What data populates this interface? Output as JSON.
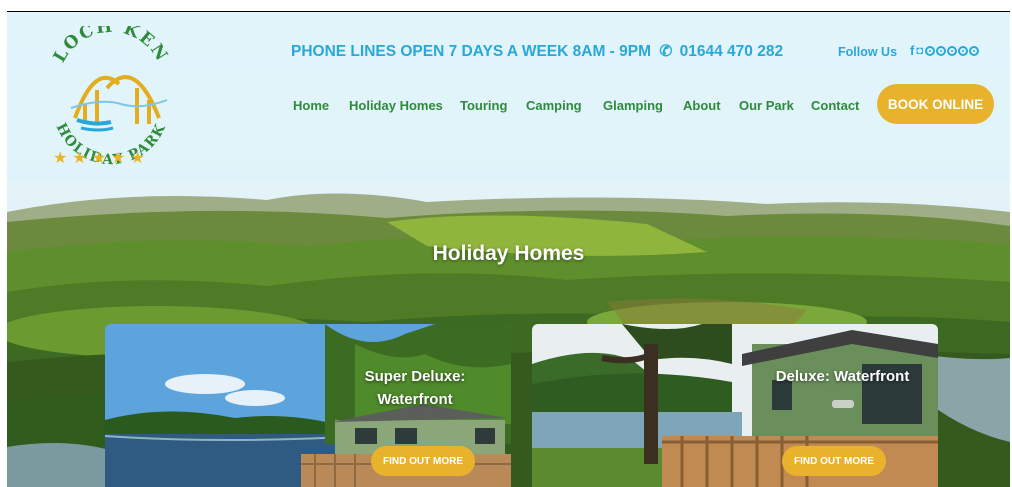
{
  "header": {
    "logo": {
      "line1": "LOCH KEN",
      "line2": "HOLIDAY PARK",
      "stars": "★★★★★"
    },
    "phone_text": "PHONE LINES OPEN 7 DAYS A WEEK 8AM - 9PM",
    "phone_number": "01644 470 282",
    "follow_us": "Follow Us",
    "social_icons": [
      "facebook-icon",
      "instagram-icon",
      "tripadvisor-icon"
    ]
  },
  "nav": {
    "items": [
      "Home",
      "Holiday Homes",
      "Touring",
      "Camping",
      "Glamping",
      "About",
      "Our Park",
      "Contact"
    ],
    "book_button": "BOOK ONLINE"
  },
  "hero": {
    "title": "Holiday Homes"
  },
  "cards": [
    {
      "title": "Super Deluxe: Waterfront",
      "button": "FIND OUT MORE"
    },
    {
      "title": "Deluxe: Waterfront",
      "button": "FIND OUT MORE"
    }
  ],
  "colors": {
    "accent_blue": "#28a8d8",
    "nav_green": "#2f8a3b",
    "button_gold": "#e9b22d",
    "header_bg": "#e2f5fb"
  }
}
